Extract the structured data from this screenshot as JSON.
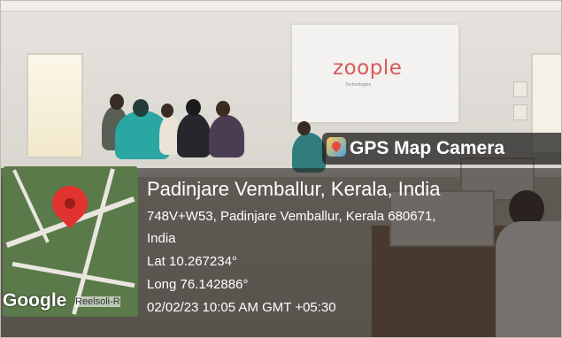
{
  "screen": {
    "logo_text": "zoople",
    "tagline": "Technologies"
  },
  "overlay": {
    "app_title": "GPS Map Camera",
    "place_name": "Padinjare Vemballur, Kerala, India",
    "address_line1": "748V+W53, Padinjare Vemballur, Kerala 680671,",
    "address_line2": "India",
    "latitude": "Lat 10.267234°",
    "longitude": "Long 76.142886°",
    "timestamp": "02/02/23 10:05 AM GMT +05:30"
  },
  "map": {
    "brand": "Google",
    "road_label": "Reelsoli-R",
    "pin_icon": "map-pin-icon"
  },
  "colors": {
    "logo": "#d8585a",
    "pin": "#e0332f",
    "overlay_text": "#ffffff"
  }
}
